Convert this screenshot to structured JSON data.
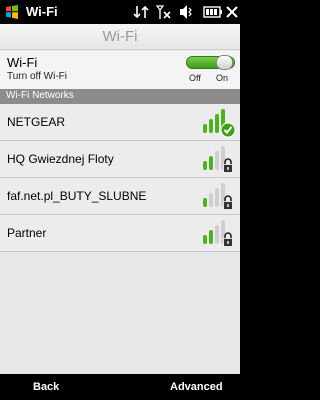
{
  "status_bar": {
    "app_title": "Wi-Fi"
  },
  "header": {
    "title": "Wi-Fi"
  },
  "wifi_setting": {
    "label": "Wi-Fi",
    "description": "Turn off Wi-Fi",
    "toggle_off_label": "Off",
    "toggle_on_label": "On",
    "state": "on",
    "accent_color": "#4fb024"
  },
  "networks_section": {
    "title": "Wi-Fi Networks"
  },
  "networks": [
    {
      "name": "NETGEAR",
      "signal_bars": 4,
      "badge": "connected-check"
    },
    {
      "name": "HQ Gwiezdnej Floty",
      "signal_bars": 2,
      "badge": "lock"
    },
    {
      "name": "faf.net.pl_BUTY_SLUBNE",
      "signal_bars": 1,
      "badge": "lock"
    },
    {
      "name": "Partner",
      "signal_bars": 2,
      "badge": "lock"
    }
  ],
  "softkeys": {
    "left": "Back",
    "right": "Advanced"
  }
}
